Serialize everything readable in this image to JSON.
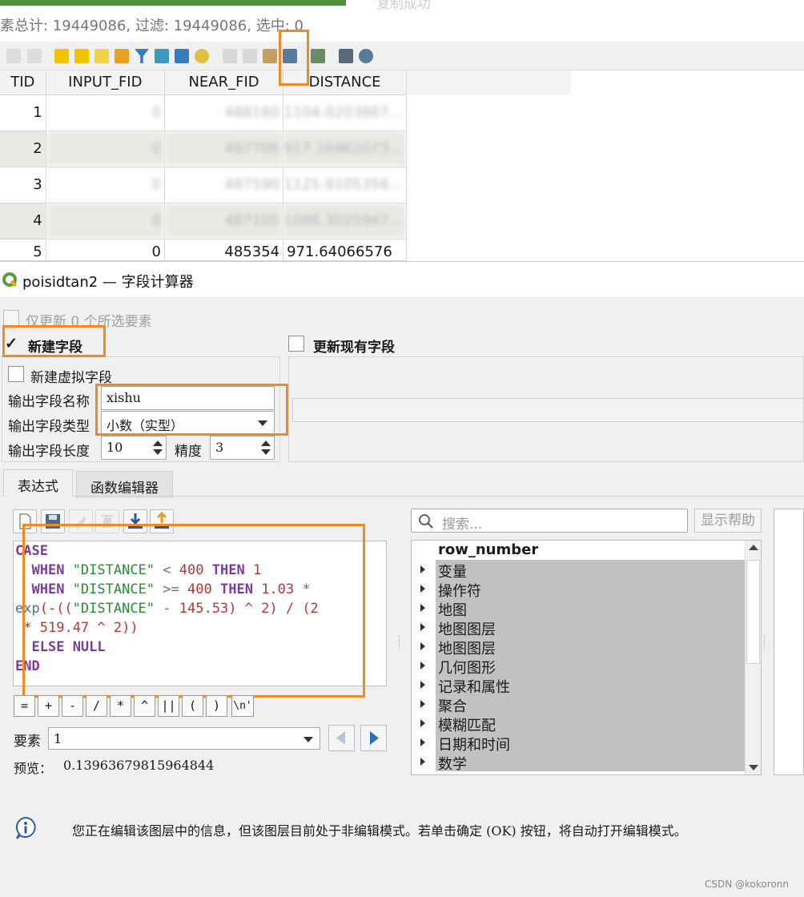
{
  "attr_table": {
    "title_fragment": "复制成功",
    "status_text": "素总计: 19449086, 过滤: 19449086, 选中: 0",
    "columns": [
      "TID",
      "INPUT_FID",
      "NEAR_FID",
      "DISTANCE"
    ],
    "rows": [
      [
        "1",
        "0",
        "488160",
        "1104.0203867..."
      ],
      [
        "2",
        "0",
        "487706",
        "917.16962073..."
      ],
      [
        "3",
        "0",
        "487590",
        "1125.9105356..."
      ],
      [
        "4",
        "0",
        "487105",
        "1086.3025947..."
      ],
      [
        "5",
        "0",
        "485354",
        "971.64066576"
      ]
    ]
  },
  "dialog": {
    "title": "poisidtan2 — 字段计算器",
    "only_selected_label": "仅更新 0 个所选要素",
    "new_field_label": "新建字段",
    "update_existing_label": "更新现有字段",
    "new_virtual_label": "新建虚拟字段",
    "output_name_label": "输出字段名称",
    "output_name_value": "xishu",
    "output_type_label": "输出字段类型",
    "output_type_value": "小数（实型）",
    "output_length_label": "输出字段长度",
    "output_length_value": "10",
    "precision_label": "精度",
    "precision_value": "3",
    "tabs": [
      "表达式",
      "函数编辑器"
    ],
    "operators": [
      "=",
      "+",
      "-",
      "/",
      "*",
      "^",
      "||",
      "(",
      ")",
      "\\n'"
    ],
    "feature_label": "要素",
    "feature_value": "1",
    "preview_label": "预览：",
    "preview_value": "0.13963679815964844",
    "search_placeholder": "搜索...",
    "help_button": "显示帮助",
    "function_tree": [
      "row_number",
      "变量",
      "操作符",
      "地图",
      "地图图层",
      "地图图层",
      "几何图形",
      "记录和属性",
      "聚合",
      "模糊匹配",
      "日期和时间",
      "数学"
    ],
    "info_message": "您正在编辑该图层中的信息，但该图层目前处于非编辑模式。若单击确定 (OK) 按钮，将自动打开编辑模式。",
    "watermark": "CSDN @kokoronn"
  },
  "code": {
    "case": "CASE",
    "when": "WHEN",
    "then": "THEN",
    "else": "ELSE",
    "null": "NULL",
    "end": "END",
    "field": "\"DISTANCE\"",
    "lt": "<",
    "gte": ">=",
    "n400": "400",
    "n1": "1",
    "n103": "1.03",
    "star": "*",
    "exp": "exp",
    "paren_open": "(-((",
    "minus": "-",
    "n14553": "145.53",
    "close_pow": ") ^ 2) / (2",
    "line5_star": "*",
    "n51947": "519.47",
    "pow2close": "^ 2))"
  },
  "colors": {
    "highlight": "#f08a24",
    "keyword": "#7a3c9a",
    "string": "#2e8b3a",
    "number": "#b03a3a"
  }
}
